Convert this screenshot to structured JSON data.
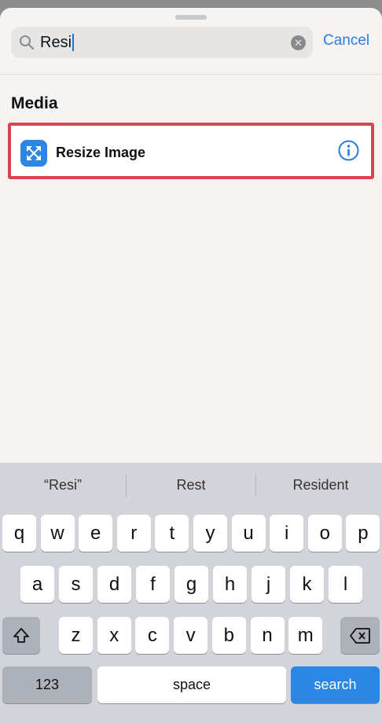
{
  "search": {
    "query": "Resi",
    "cancel_label": "Cancel"
  },
  "results": {
    "section_title": "Media",
    "items": [
      {
        "label": "Resize Image",
        "icon": "resize-arrows-icon",
        "icon_color": "#2b87e3"
      }
    ]
  },
  "highlight_color": "#d9454f",
  "keyboard": {
    "suggestions": [
      "“Resi”",
      "Rest",
      "Resident"
    ],
    "row1": [
      "q",
      "w",
      "e",
      "r",
      "t",
      "y",
      "u",
      "i",
      "o",
      "p"
    ],
    "row2": [
      "a",
      "s",
      "d",
      "f",
      "g",
      "h",
      "j",
      "k",
      "l"
    ],
    "row3": [
      "z",
      "x",
      "c",
      "v",
      "b",
      "n",
      "m"
    ],
    "numbers_label": "123",
    "space_label": "space",
    "search_label": "search"
  }
}
